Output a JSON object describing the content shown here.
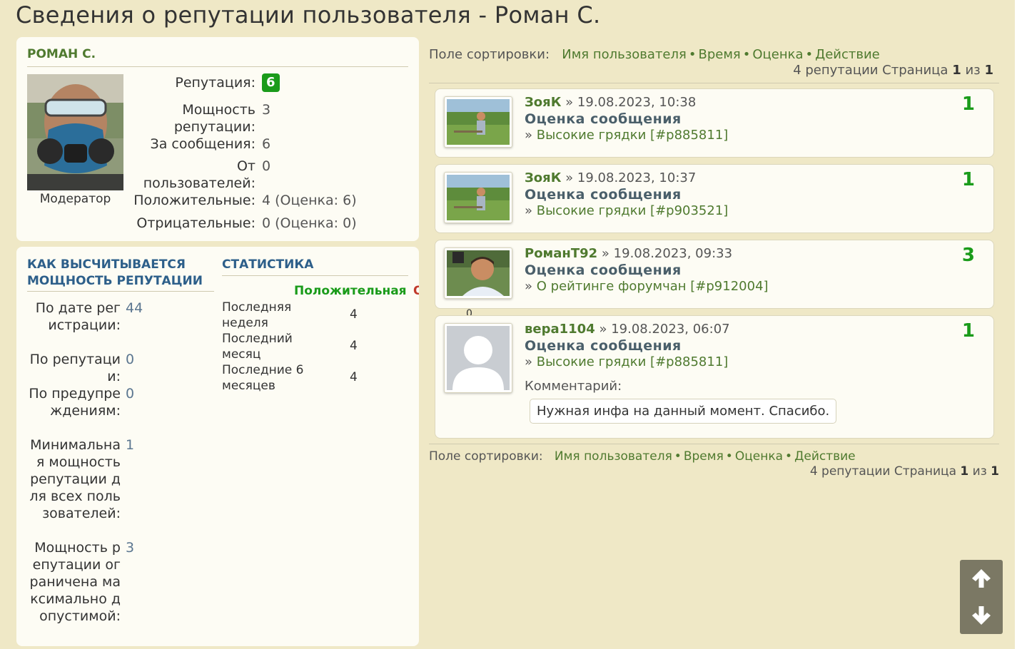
{
  "page": {
    "title": "Сведения о репутации пользователя - Роман С."
  },
  "profile": {
    "username": "РОМАН С.",
    "role": "Модератор",
    "reputation_label": "Репутация:",
    "reputation_value": "6",
    "rows": [
      {
        "label": "Мощность репутации:",
        "value": "3"
      },
      {
        "label": "За сообщения:",
        "value": "6"
      },
      {
        "label": "От пользователей:",
        "value": "0"
      },
      {
        "label": "Положительные:",
        "value": "4 (Оценка: 6)"
      },
      {
        "label": "Отрицательные:",
        "value": "0 (Оценка: 0)"
      }
    ]
  },
  "power": {
    "title_line1": "КАК ВЫСЧИТЫВАЕТСЯ",
    "title_line2": "МОЩНОСТЬ РЕПУТАЦИИ",
    "rows": [
      {
        "label": "По дате регистрации:",
        "value": "44"
      },
      {
        "label": "По репутации:",
        "value": "0"
      },
      {
        "label": "По предупреждениям:",
        "value": "0"
      },
      {
        "label": "Минимальная мощность репутации для всех пользователей:",
        "value": "1"
      },
      {
        "label": "Мощность репутации ограничена максимально допустимой:",
        "value": "3"
      }
    ]
  },
  "stats": {
    "title": "СТАТИСТИКА",
    "col_positive": "Положительная",
    "col_negative": "Отрицательная",
    "overflow_value": "0",
    "rows": [
      {
        "label": "Последняя неделя",
        "value": "4"
      },
      {
        "label": "Последний месяц",
        "value": "4"
      },
      {
        "label": "Последние 6 месяцев",
        "value": "4"
      }
    ]
  },
  "sort": {
    "label": "Поле сортировки:",
    "options": [
      "Имя пользователя",
      "Время",
      "Оценка",
      "Действие"
    ],
    "separator": "•"
  },
  "pager": {
    "count_text": "4 репутации Страница",
    "current": "1",
    "of_text": "из",
    "total": "1"
  },
  "entries": [
    {
      "user": "ЗояК",
      "date": "19.08.2023, 10:38",
      "type": "Оценка сообщения",
      "topic": "Высокие грядки",
      "post": "[#p885811]",
      "score": "1",
      "avatar": "field-photo"
    },
    {
      "user": "ЗояК",
      "date": "19.08.2023, 10:37",
      "type": "Оценка сообщения",
      "topic": "Высокие грядки",
      "post": "[#p903521]",
      "score": "1",
      "avatar": "field-photo"
    },
    {
      "user": "РоманТ92",
      "date": "19.08.2023, 09:33",
      "type": "Оценка сообщения",
      "topic": "О рейтинге форумчан",
      "post": "[#p912004]",
      "score": "3",
      "avatar": "boy-photo"
    },
    {
      "user": "вера1104",
      "date": "19.08.2023, 06:07",
      "type": "Оценка сообщения",
      "topic": "Высокие грядки",
      "post": "[#p885811]",
      "score": "1",
      "avatar": "default-avatar",
      "comment_label": "Комментарий:",
      "comment": "Нужная инфа на данный момент. Спасибо."
    }
  ],
  "entry_common": {
    "arrow": "»",
    "topic_arrow": "»"
  },
  "colors": {
    "background": "#efe8c6",
    "panel": "#fdfcf4",
    "link": "#4f7a2f",
    "score": "#1a9b1a",
    "heading_blue": "#2d5f8a",
    "negative": "#c0392b"
  },
  "icons": {
    "scroll_up": "arrow-up-icon",
    "scroll_down": "arrow-down-icon"
  }
}
